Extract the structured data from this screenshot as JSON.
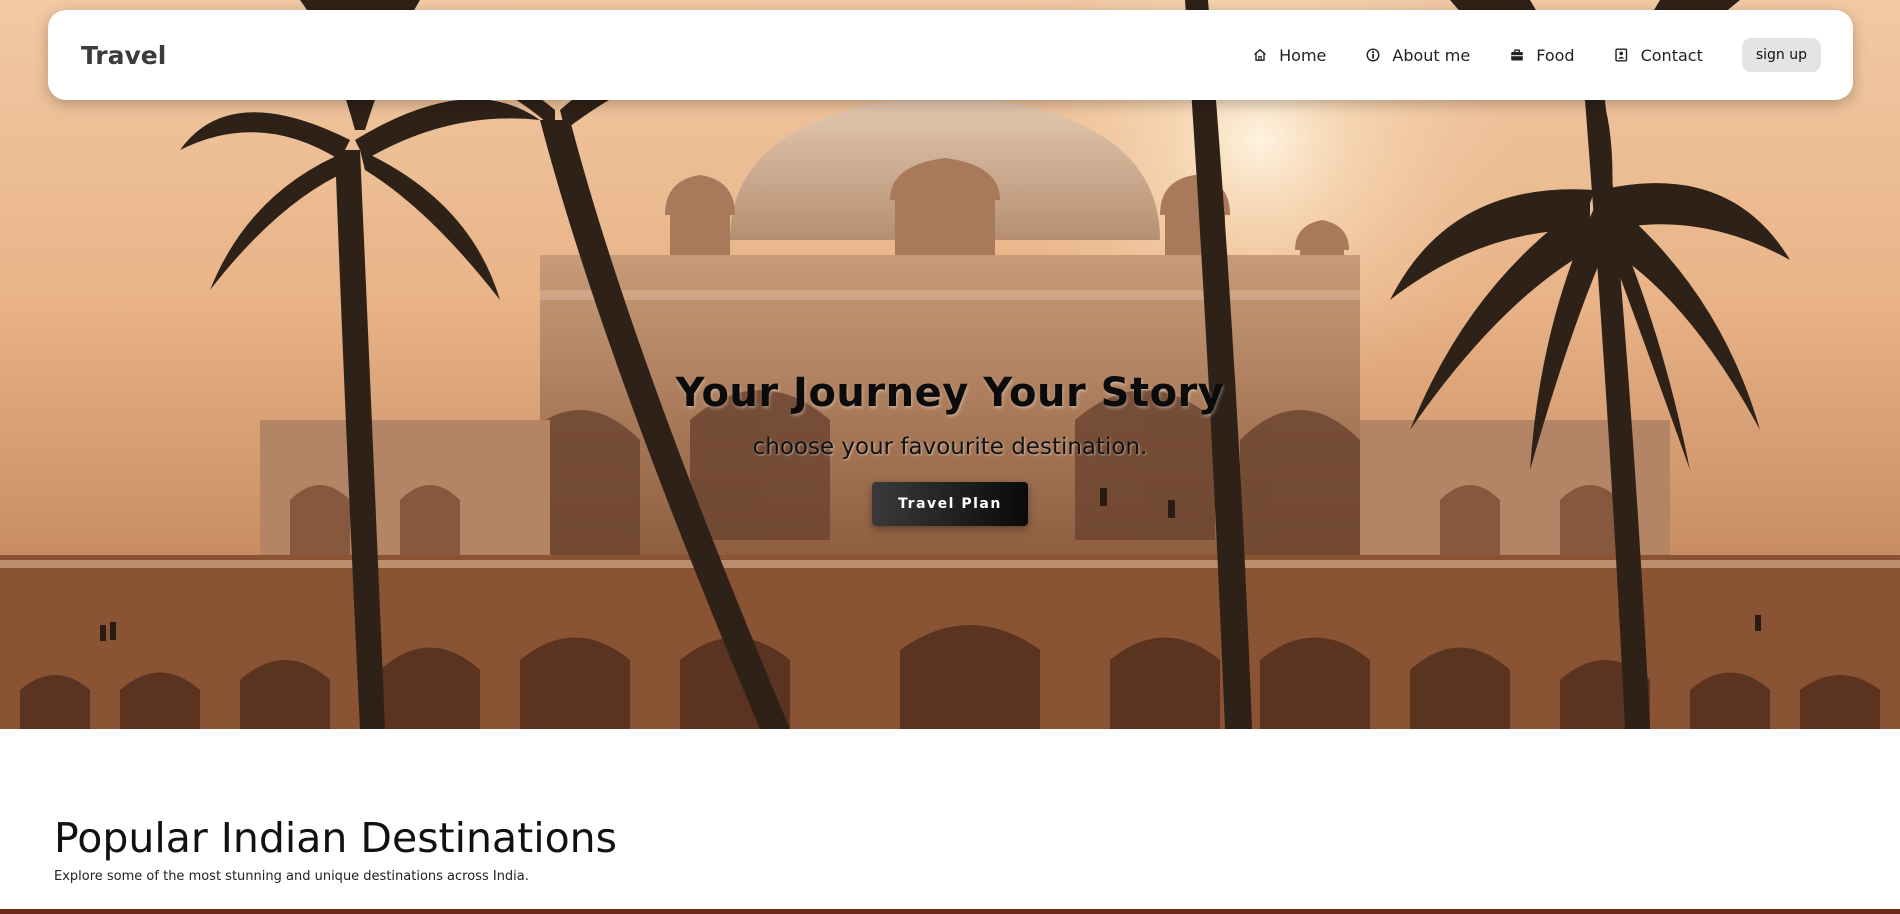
{
  "navbar": {
    "brand": "Travel",
    "links": [
      {
        "label": "Home",
        "icon": "home-icon"
      },
      {
        "label": "About me",
        "icon": "info-icon"
      },
      {
        "label": "Food",
        "icon": "briefcase-icon"
      },
      {
        "label": "Contact",
        "icon": "contact-book-icon"
      }
    ],
    "signup_label": "sign up"
  },
  "hero": {
    "title": "Your Journey Your Story",
    "subtitle": "choose your favourite destination.",
    "button_label": "Travel Plan"
  },
  "section": {
    "title": "Popular Indian Destinations",
    "description": "Explore some of the most stunning and unique destinations across India."
  },
  "colors": {
    "hero_sky": "#f1c9a4",
    "monument": "#9a6a4a",
    "palm": "#2e2118",
    "bottom_bar": "#6b2a1a",
    "signup_bg": "#e4e4e4"
  }
}
